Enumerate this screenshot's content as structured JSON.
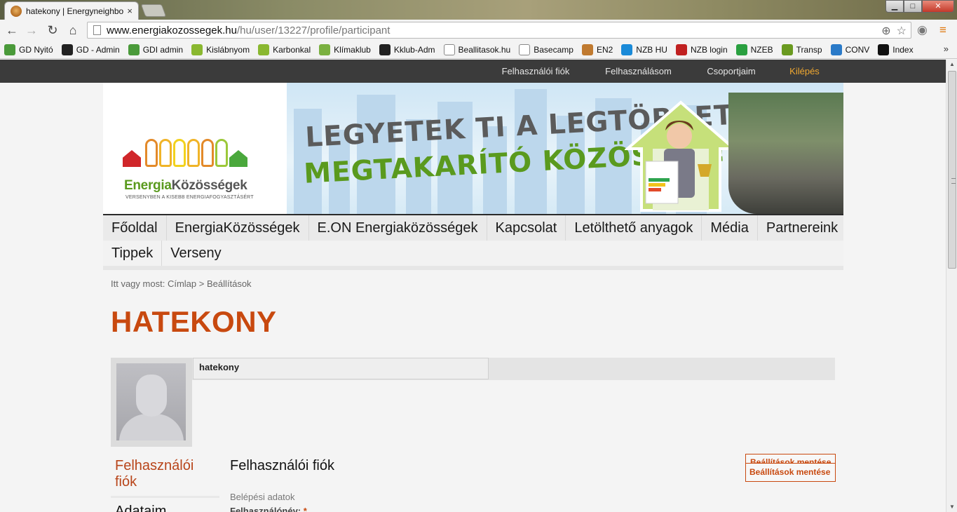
{
  "browser": {
    "tab_title": "hatekony | Energyneighbo",
    "tab_close": "×",
    "url_host": "www.energiakozossegek.hu",
    "url_path": "/hu/user/13227/profile/participant",
    "nav": {
      "back": "←",
      "forward": "→",
      "reload": "↻",
      "home": "⌂"
    },
    "window_controls": {
      "minimize": "▁",
      "maximize": "□",
      "close": "✕"
    },
    "bookmarks": [
      {
        "label": "GD Nyitó",
        "icon": "gd-icon",
        "color": "#4a9a3a"
      },
      {
        "label": "GD - Admin",
        "icon": "gd-admin-icon",
        "color": "#222222"
      },
      {
        "label": "GDI admin",
        "icon": "gdi-icon",
        "color": "#4a9a3a"
      },
      {
        "label": "Kislábnyom",
        "icon": "co2-icon",
        "color": "#8ab830"
      },
      {
        "label": "Karbonkal",
        "icon": "co2-icon",
        "color": "#8ab830"
      },
      {
        "label": "Klímaklub",
        "icon": "leaf-icon",
        "color": "#7ab040"
      },
      {
        "label": "Kklub-Adm",
        "icon": "admin-icon",
        "color": "#222222"
      },
      {
        "label": "Beallitasok.hu",
        "icon": "page-icon",
        "color": "#ffffff"
      },
      {
        "label": "Basecamp",
        "icon": "page-icon",
        "color": "#ffffff"
      },
      {
        "label": "EN2",
        "icon": "bear-icon",
        "color": "#c07a30"
      },
      {
        "label": "NZB HU",
        "icon": "nzb-icon",
        "color": "#1a8ad8"
      },
      {
        "label": "NZB login",
        "icon": "cc-icon",
        "color": "#c02020"
      },
      {
        "label": "NZEB",
        "icon": "nzeb-icon",
        "color": "#2aa040"
      },
      {
        "label": "Transp",
        "icon": "magnifier-icon",
        "color": "#6a9a20"
      },
      {
        "label": "CONV",
        "icon": "conv-icon",
        "color": "#2a7ac8"
      },
      {
        "label": "Index",
        "icon": "index-icon",
        "color": "#111111"
      }
    ],
    "bookmarks_more": "»"
  },
  "topnav": {
    "items": [
      "Felhasználói fiók",
      "Felhasználásom",
      "Csoportjaim"
    ],
    "logout": "Kilépés"
  },
  "banner": {
    "logo_word1": "Energia",
    "logo_word2": "Közösségek",
    "logo_tagline": "VERSENYBEN A KISEBB ENERGIAFOGYASZTÁSÉRT",
    "slogan_line1": "LEGYETEK TI A LEGTÖBBET",
    "slogan_line2": "MEGTAKARÍTÓ KÖZÖSSÉG!"
  },
  "mainnav": {
    "row1": [
      "Főoldal",
      "EnergiaKözösségek",
      "E.ON Energiaközösségek",
      "Kapcsolat",
      "Letölthető anyagok",
      "Média",
      "Partnereink"
    ],
    "row2": [
      "Tippek",
      "Verseny"
    ]
  },
  "breadcrumb": {
    "prefix": "Itt vagy most:",
    "home": "Címlap",
    "sep": ">",
    "current": "Beállítások"
  },
  "page": {
    "title": "HATEKONY",
    "username": "hatekony"
  },
  "sidenav": {
    "items": [
      "Felhasználói fiók",
      "Adataim"
    ]
  },
  "form": {
    "section_title": "Felhasználói fiók",
    "save_label": "Beállítások mentése",
    "fieldset_label": "Belépési adatok",
    "username_label": "Felhasználónév:",
    "required_mark": "*"
  },
  "colors": {
    "accent": "#c8490f",
    "topbar": "#3b3b3b",
    "logout": "#f0a830"
  }
}
